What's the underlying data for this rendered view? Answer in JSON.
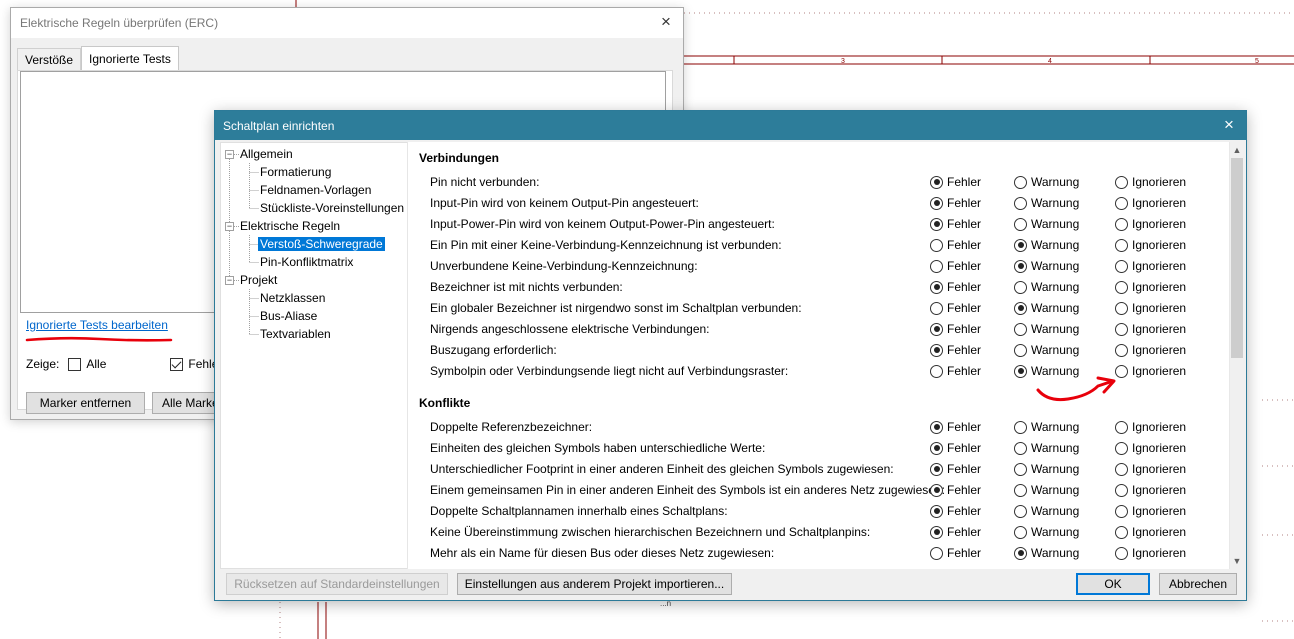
{
  "schematic": {
    "ruler_labels": [
      "3",
      "4",
      "5"
    ],
    "bottom_text": "...n"
  },
  "erc": {
    "title": "Elektrische Regeln überprüfen (ERC)",
    "tabs": [
      {
        "label": "Verstöße",
        "active": false
      },
      {
        "label": "Ignorierte Tests",
        "active": true
      }
    ],
    "edit_link": "Ignorierte Tests bearbeiten",
    "show_label": "Zeige:",
    "filter_all": {
      "label": "Alle",
      "checked": false
    },
    "filter_errors": {
      "label": "Fehler",
      "checked": true
    },
    "remove_markers_button": "Marker entfernen",
    "all_markers_button": "Alle Marke"
  },
  "setup": {
    "title": "Schaltplan einrichten",
    "tree": {
      "allgemein": "Allgemein",
      "formatierung": "Formatierung",
      "feldnamen": "Feldnamen-Vorlagen",
      "stueckliste": "Stückliste-Voreinstellungen",
      "elektrische_regeln": "Elektrische Regeln",
      "verstoss": "Verstoß-Schweregrade",
      "pin_konflikt": "Pin-Konfliktmatrix",
      "projekt": "Projekt",
      "netzklassen": "Netzklassen",
      "bus_aliase": "Bus-Aliase",
      "textvariablen": "Textvariablen",
      "expander_minus": "−"
    },
    "option_labels": {
      "error": "Fehler",
      "warning": "Warnung",
      "ignore": "Ignorieren"
    },
    "sections": [
      {
        "title": "Verbindungen",
        "rules": [
          {
            "label": "Pin nicht verbunden:",
            "selected": "error"
          },
          {
            "label": "Input-Pin wird von keinem Output-Pin angesteuert:",
            "selected": "error"
          },
          {
            "label": "Input-Power-Pin wird von keinem Output-Power-Pin angesteuert:",
            "selected": "error"
          },
          {
            "label": "Ein Pin mit einer Keine-Verbindung-Kennzeichnung ist verbunden:",
            "selected": "warning"
          },
          {
            "label": "Unverbundene Keine-Verbindung-Kennzeichnung:",
            "selected": "warning"
          },
          {
            "label": "Bezeichner ist mit nichts verbunden:",
            "selected": "error"
          },
          {
            "label": "Ein globaler Bezeichner ist nirgendwo sonst im Schaltplan verbunden:",
            "selected": "warning"
          },
          {
            "label": "Nirgends angeschlossene elektrische Verbindungen:",
            "selected": "error"
          },
          {
            "label": "Buszugang erforderlich:",
            "selected": "error"
          },
          {
            "label": "Symbolpin oder Verbindungsende liegt nicht auf Verbindungsraster:",
            "selected": "warning"
          }
        ]
      },
      {
        "title": "Konflikte",
        "rules": [
          {
            "label": "Doppelte Referenzbezeichner:",
            "selected": "error"
          },
          {
            "label": "Einheiten des gleichen Symbols haben unterschiedliche Werte:",
            "selected": "error"
          },
          {
            "label": "Unterschiedlicher Footprint in einer anderen Einheit des gleichen Symbols zugewiesen:",
            "selected": "error"
          },
          {
            "label": "Einem gemeinsamen Pin in einer anderen Einheit des Symbols ist ein anderes Netz zugewiesen:",
            "selected": "error"
          },
          {
            "label": "Doppelte Schaltplannamen innerhalb eines Schaltplans:",
            "selected": "error"
          },
          {
            "label": "Keine Übereinstimmung zwischen hierarchischen Bezeichnern und Schaltplanpins:",
            "selected": "error"
          },
          {
            "label": "Mehr als ein Name für diesen Bus oder dieses Netz zugewiesen:",
            "selected": "warning"
          }
        ]
      }
    ],
    "buttons": {
      "reset": "Rücksetzen auf Standardeinstellungen",
      "import": "Einstellungen aus anderem Projekt importieren...",
      "ok": "OK",
      "cancel": "Abbrechen"
    }
  },
  "colors": {
    "titlebar": "#2d7d9a",
    "annotation_red": "#e8000b",
    "schematic_border": "#8b0000",
    "link": "#0066cc",
    "selection": "#0078d7"
  },
  "icons": {
    "close": "×",
    "scroll_up": "▲",
    "scroll_down": "▼"
  }
}
